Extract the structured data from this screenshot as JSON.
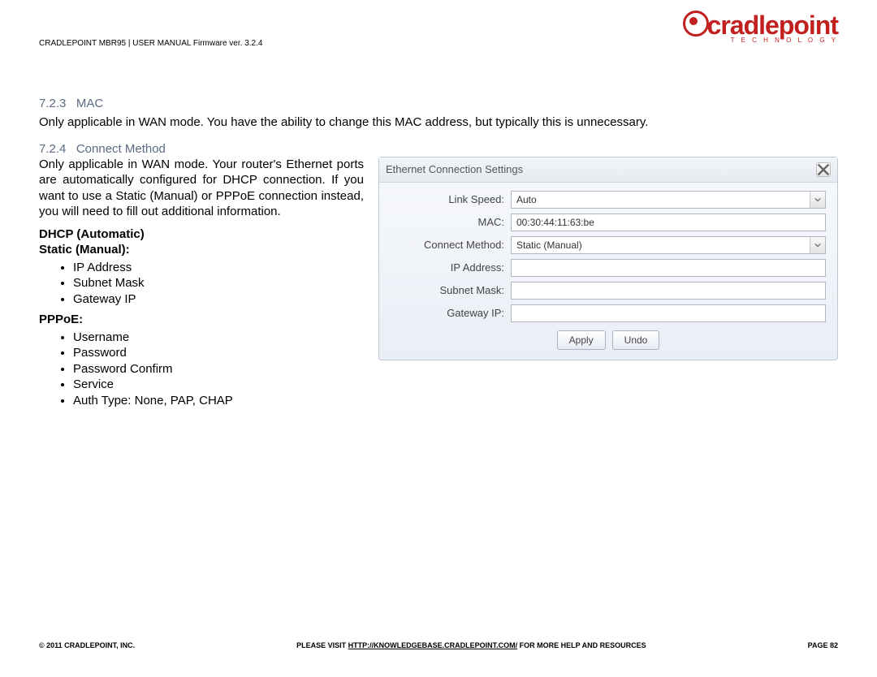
{
  "logo": {
    "brand": "cradlepoint",
    "sub": "T E C H N O L O G Y"
  },
  "header_line": "CRADLEPOINT MBR95 | USER MANUAL Firmware ver. 3.2.4",
  "sec1": {
    "num": "7.2.3",
    "title": "MAC",
    "para": "Only applicable in WAN mode. You have the ability to change this MAC address, but typically this is unnecessary."
  },
  "sec2": {
    "num": "7.2.4",
    "title": "Connect Method",
    "para": "Only applicable in WAN mode. Your router's Ethernet ports are automatically configured for DHCP connection. If you want to use a Static (Manual) or PPPoE connection instead, you will need to fill out additional information."
  },
  "lists": {
    "dhcp_label": "DHCP (Automatic)",
    "static_label": "Static (Manual):",
    "static_items": [
      "IP Address",
      "Subnet Mask",
      "Gateway IP"
    ],
    "pppoe_label": "PPPoE:",
    "pppoe_items": [
      "Username",
      "Password",
      "Password Confirm",
      "Service",
      "Auth Type: None, PAP, CHAP"
    ]
  },
  "panel": {
    "title": "Ethernet Connection Settings",
    "rows": {
      "link_speed_label": "Link Speed:",
      "link_speed_value": "Auto",
      "mac_label": "MAC:",
      "mac_value": "00:30:44:11:63:be",
      "connect_label": "Connect Method:",
      "connect_value": "Static (Manual)",
      "ip_label": "IP Address:",
      "subnet_label": "Subnet Mask:",
      "gateway_label": "Gateway IP:"
    },
    "apply": "Apply",
    "undo": "Undo"
  },
  "footer": {
    "left": "© 2011 CRADLEPOINT, INC.",
    "mid_pre": "PLEASE VISIT ",
    "mid_link": "HTTP://KNOWLEDGEBASE.CRADLEPOINT.COM/",
    "mid_post": " FOR MORE HELP AND RESOURCES",
    "right": "PAGE 82"
  }
}
